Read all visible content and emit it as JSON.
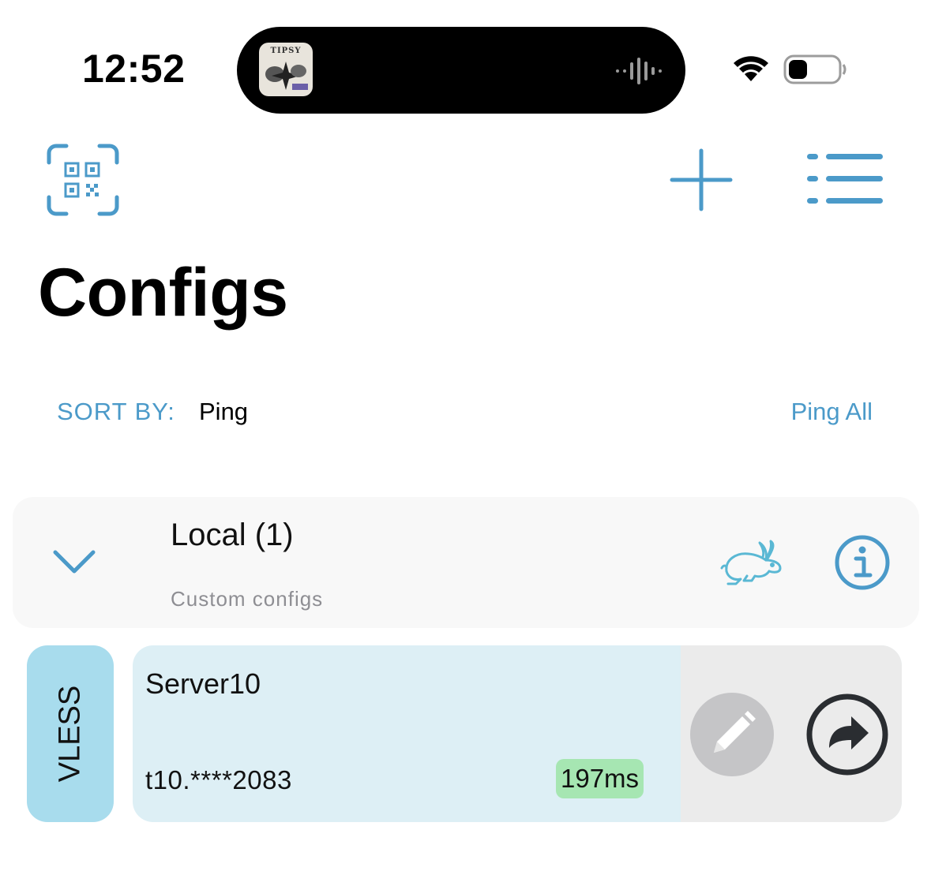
{
  "status_bar": {
    "time": "12:52",
    "now_playing_album_text": "TIPSY"
  },
  "toolbar": {
    "qr_icon": "qr-scan-icon",
    "add_icon": "plus-icon",
    "menu_icon": "list-icon"
  },
  "page": {
    "title": "Configs"
  },
  "sort": {
    "label": "SORT BY:",
    "value": "Ping",
    "ping_all_label": "Ping All"
  },
  "group": {
    "title": "Local (1)",
    "subtitle": "Custom configs",
    "expanded": true
  },
  "configs": [
    {
      "protocol": "VLESS",
      "name": "Server10",
      "address": "t10.****2083",
      "ping": "197ms"
    }
  ],
  "colors": {
    "accent": "#4b9ac9",
    "protocol_badge": "#a8dced",
    "config_card": "#ddeff5",
    "ping_good": "#a6e6b2",
    "group_card": "#f8f8f8"
  }
}
